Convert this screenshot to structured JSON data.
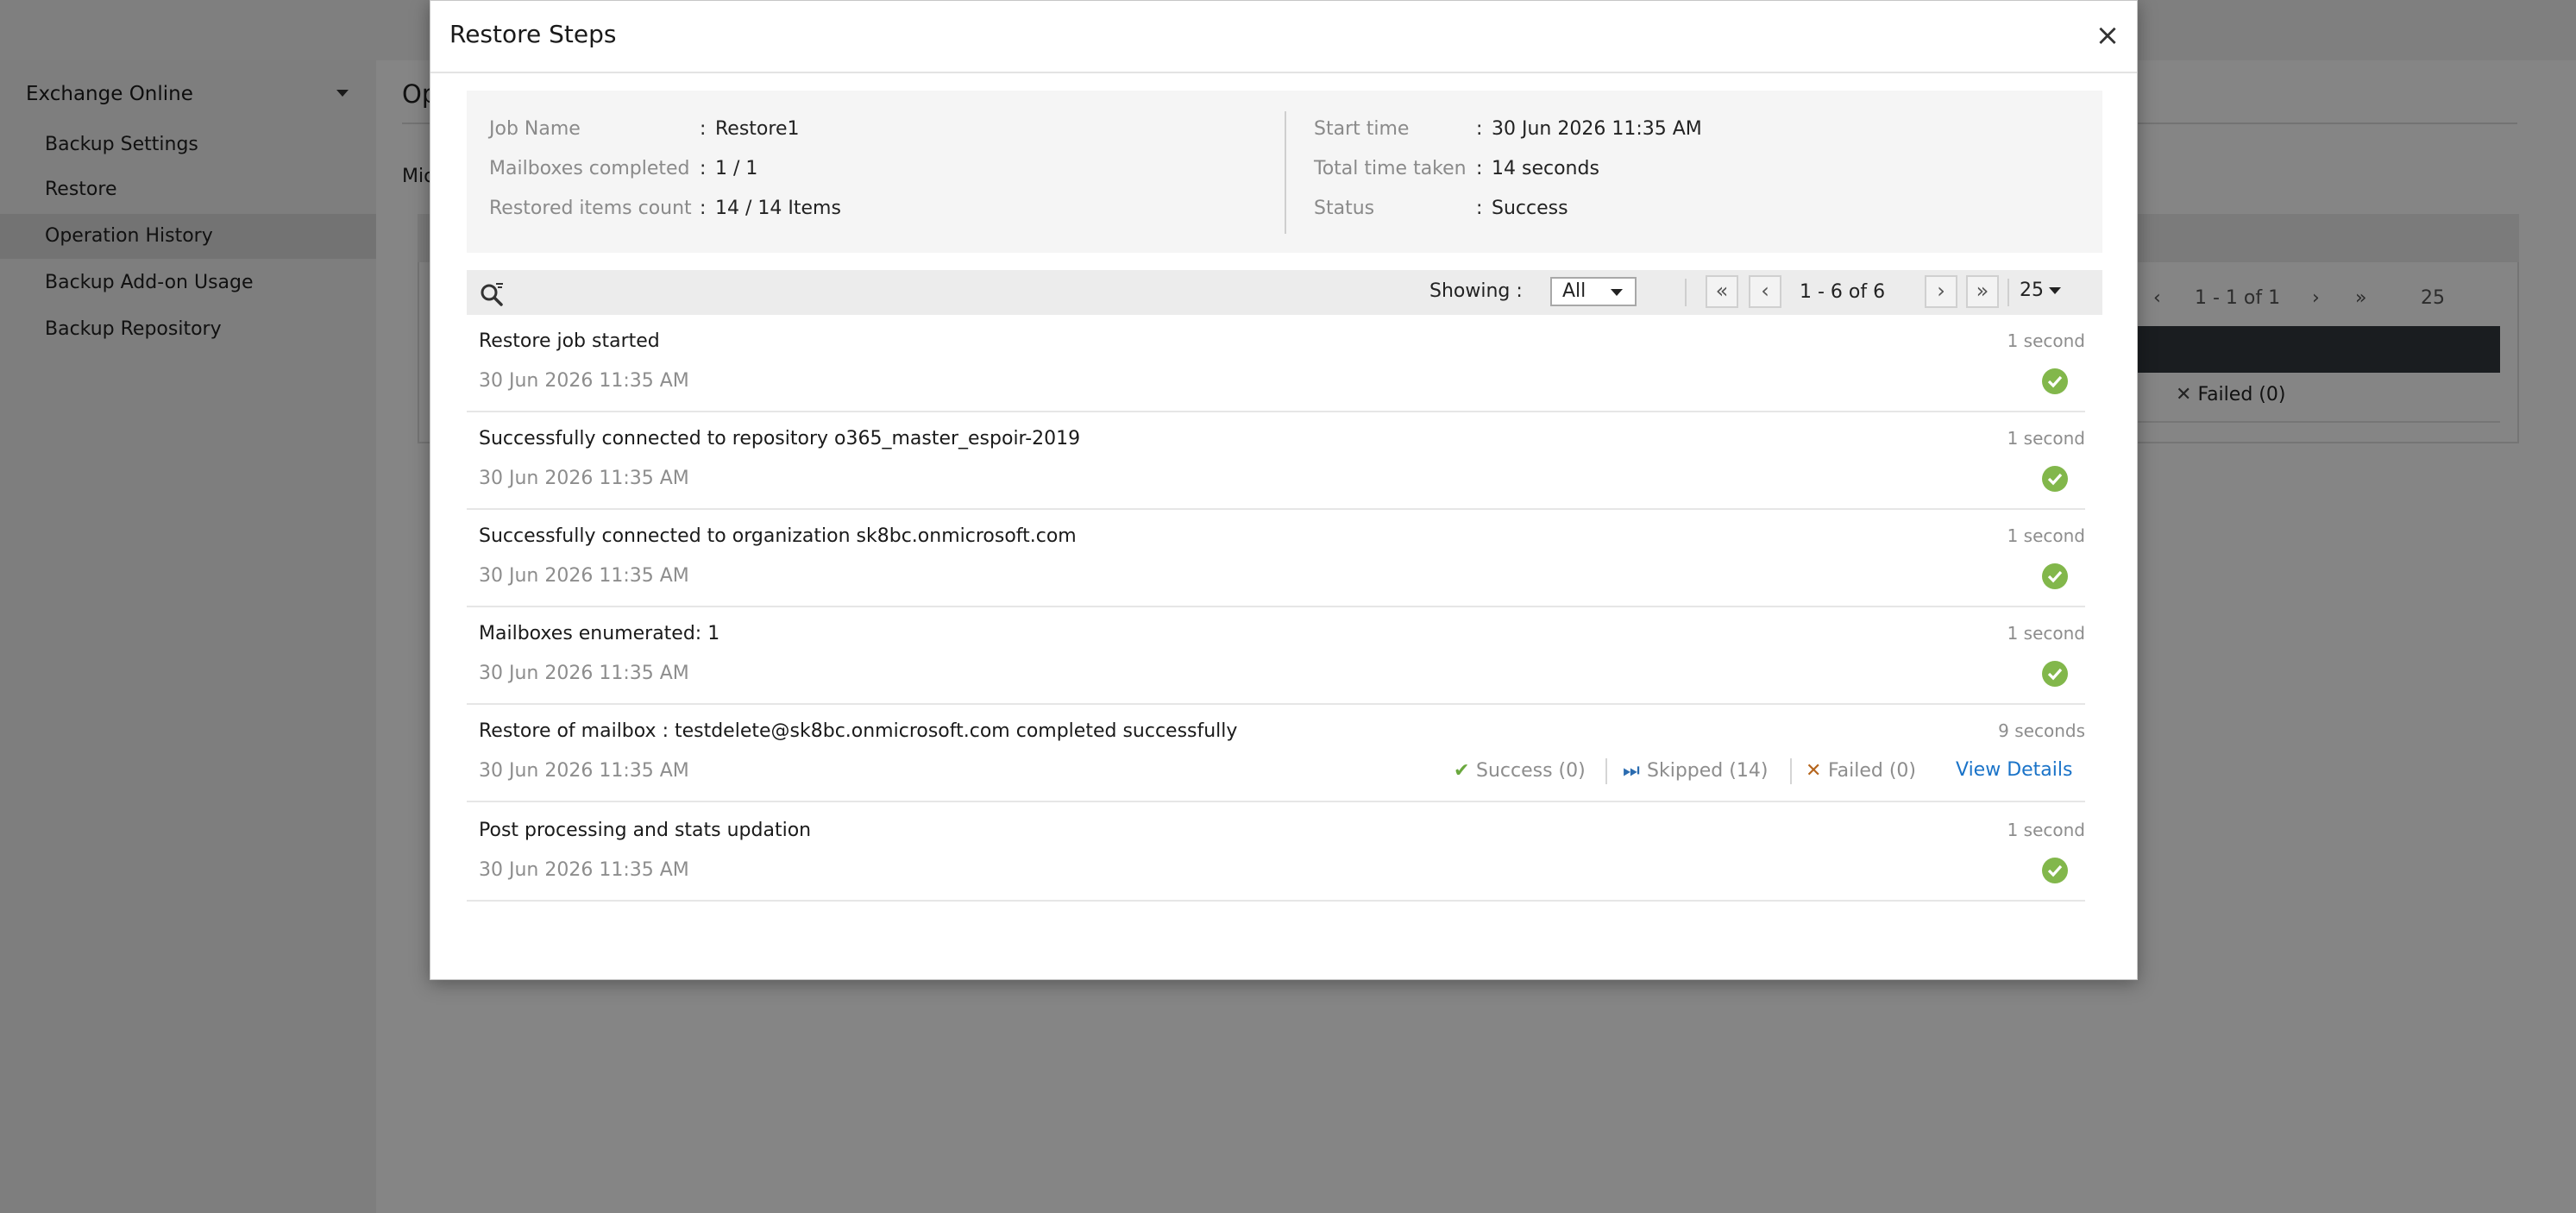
{
  "sidebar": {
    "header": "Exchange Online",
    "items": [
      {
        "label": "Backup Settings"
      },
      {
        "label": "Restore"
      },
      {
        "label": "Operation History"
      },
      {
        "label": "Backup Add-on Usage"
      },
      {
        "label": "Backup Repository"
      }
    ]
  },
  "background": {
    "title_fragment": "Op",
    "subtitle_fragment": "Mic",
    "pager_text": "1 - 1 of 1",
    "per_page": "25",
    "failed_label": "Failed (0)"
  },
  "modal": {
    "title": "Restore Steps",
    "close_glyph": "×",
    "summary": {
      "left": [
        {
          "label": "Job Name",
          "value": "Restore1"
        },
        {
          "label": "Mailboxes completed",
          "value": "1 / 1"
        },
        {
          "label": "Restored items count",
          "value": "14 / 14 Items"
        }
      ],
      "right": [
        {
          "label": "Start time",
          "value": "30 Jun 2026 11:35 AM"
        },
        {
          "label": "Total time taken",
          "value": "14 seconds"
        },
        {
          "label": "Status",
          "value": "Success"
        }
      ]
    },
    "toolbar": {
      "showing_label": "Showing :",
      "filter_value": "All",
      "pager_text": "1 - 6 of 6",
      "per_page": "25"
    },
    "steps": [
      {
        "title": "Restore job started",
        "time": "30 Jun 2026 11:35 AM",
        "duration": "1 second",
        "status": "success"
      },
      {
        "title": "Successfully connected to repository o365_master_espoir-2019",
        "time": "30 Jun 2026 11:35 AM",
        "duration": "1 second",
        "status": "success"
      },
      {
        "title": "Successfully connected to organization sk8bc.onmicrosoft.com",
        "time": "30 Jun 2026 11:35 AM",
        "duration": "1 second",
        "status": "success"
      },
      {
        "title": "Mailboxes enumerated: 1",
        "time": "30 Jun 2026 11:35 AM",
        "duration": "1 second",
        "status": "success"
      },
      {
        "title": "Restore of mailbox : testdelete@sk8bc.onmicrosoft.com completed successfully",
        "time": "30 Jun 2026 11:35 AM",
        "duration": "9 seconds",
        "status": "detail",
        "stats": {
          "success": "Success (0)",
          "skipped": "Skipped (14)",
          "failed": "Failed (0)",
          "link": "View Details"
        }
      },
      {
        "title": "Post processing and stats updation",
        "time": "30 Jun 2026 11:35 AM",
        "duration": "1 second",
        "status": "success"
      }
    ]
  },
  "colors": {
    "success_green": "#82b74b",
    "link_blue": "#1a73c8",
    "failed_orange": "#b5651d",
    "overlay": "rgba(0,0,0,0.48)"
  },
  "icons": [
    "search-filter-icon",
    "close-icon",
    "first-page-icon",
    "prev-page-icon",
    "next-page-icon",
    "last-page-icon",
    "success-check-icon",
    "skipped-icon",
    "failed-x-icon"
  ]
}
